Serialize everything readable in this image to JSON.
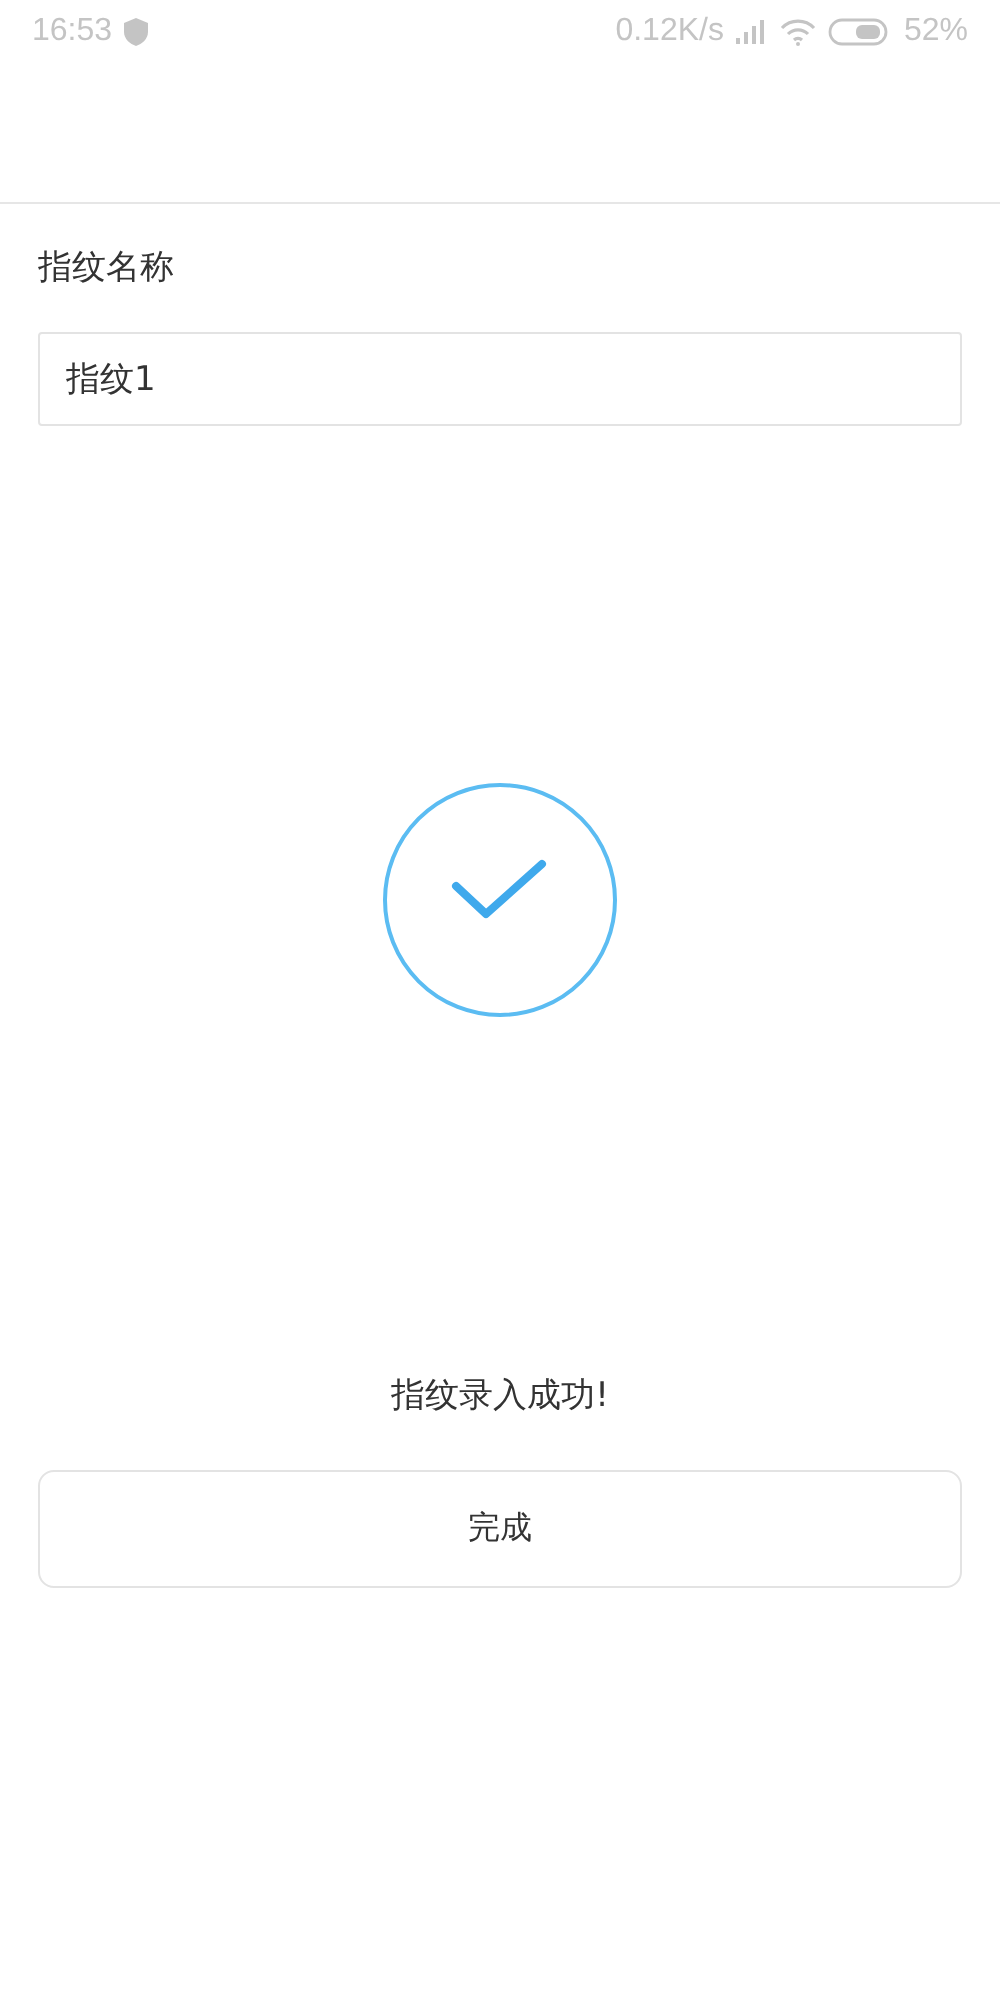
{
  "status_bar": {
    "time": "16:53",
    "speed": "0.12K/s",
    "battery": "52%"
  },
  "name_label": "指纹名称",
  "name_field": {
    "value": "指纹1"
  },
  "message": "指纹录入成功!",
  "done_button": "完成"
}
